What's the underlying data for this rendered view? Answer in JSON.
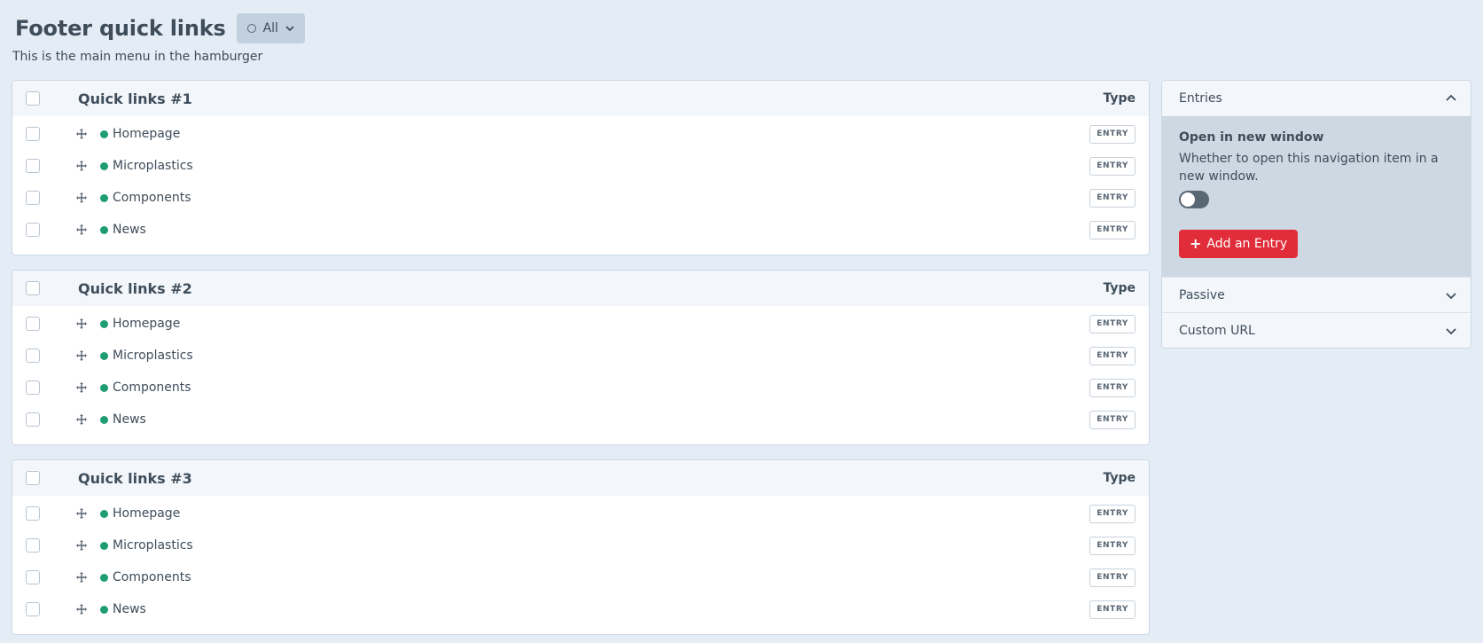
{
  "header": {
    "title": "Footer quick links",
    "site_filter_label": "All",
    "description": "This is the main menu in the hamburger"
  },
  "menus": [
    {
      "title": "Quick links #1",
      "type_header": "Type",
      "items": [
        {
          "label": "Homepage",
          "type": "ENTRY"
        },
        {
          "label": "Microplastics",
          "type": "ENTRY"
        },
        {
          "label": "Components",
          "type": "ENTRY"
        },
        {
          "label": "News",
          "type": "ENTRY"
        }
      ]
    },
    {
      "title": "Quick links #2",
      "type_header": "Type",
      "items": [
        {
          "label": "Homepage",
          "type": "ENTRY"
        },
        {
          "label": "Microplastics",
          "type": "ENTRY"
        },
        {
          "label": "Components",
          "type": "ENTRY"
        },
        {
          "label": "News",
          "type": "ENTRY"
        }
      ]
    },
    {
      "title": "Quick links #3",
      "type_header": "Type",
      "items": [
        {
          "label": "Homepage",
          "type": "ENTRY"
        },
        {
          "label": "Microplastics",
          "type": "ENTRY"
        },
        {
          "label": "Components",
          "type": "ENTRY"
        },
        {
          "label": "News",
          "type": "ENTRY"
        }
      ]
    }
  ],
  "sidebar": {
    "entries_title": "Entries",
    "option_label": "Open in new window",
    "option_instructions": "Whether to open this navigation item in a new window.",
    "toggle_on": false,
    "add_button": "Add an Entry",
    "passive_title": "Passive",
    "custom_url_title": "Custom URL"
  },
  "colors": {
    "status_enabled": "#1e9d6f",
    "accent_button": "#e12d39",
    "background": "#e4ecf6"
  }
}
